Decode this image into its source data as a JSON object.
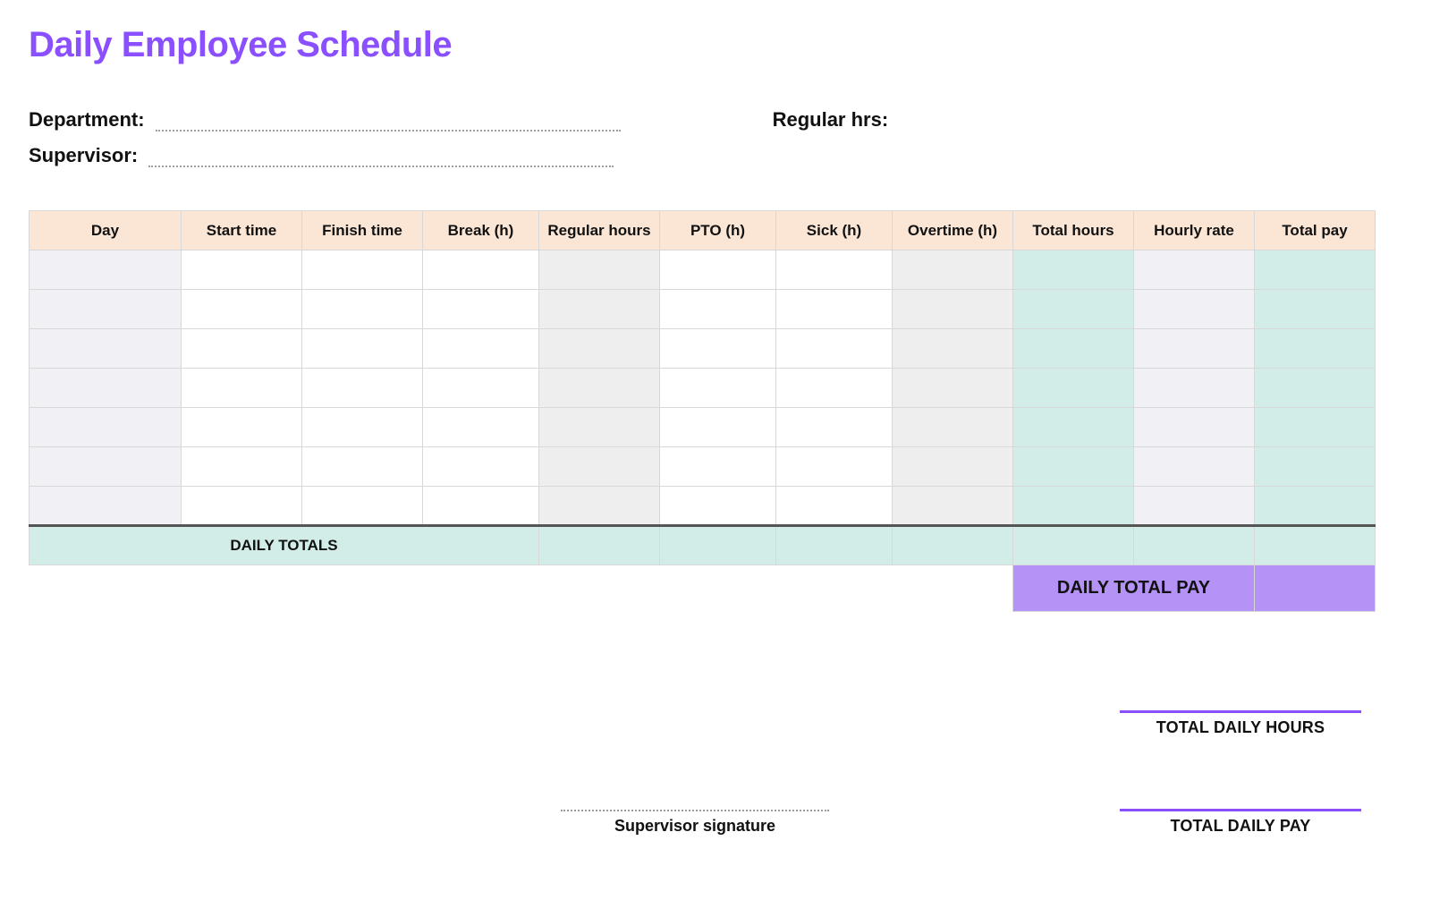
{
  "title": "Daily Employee Schedule",
  "meta": {
    "department_label": "Department:",
    "supervisor_label": "Supervisor:",
    "regular_hrs_label": "Regular hrs:"
  },
  "columns": [
    "Day",
    "Start time",
    "Finish time",
    "Break (h)",
    "Regular hours",
    "PTO (h)",
    "Sick (h)",
    "Overtime (h)",
    "Total hours",
    "Hourly rate",
    "Total pay"
  ],
  "row_count": 7,
  "footer": {
    "daily_totals_label": "DAILY TOTALS",
    "daily_total_pay_label": "DAILY TOTAL PAY"
  },
  "summary": {
    "supervisor_signature_label": "Supervisor signature",
    "total_daily_hours_label": "TOTAL DAILY HOURS",
    "total_daily_pay_label": "TOTAL DAILY PAY"
  }
}
